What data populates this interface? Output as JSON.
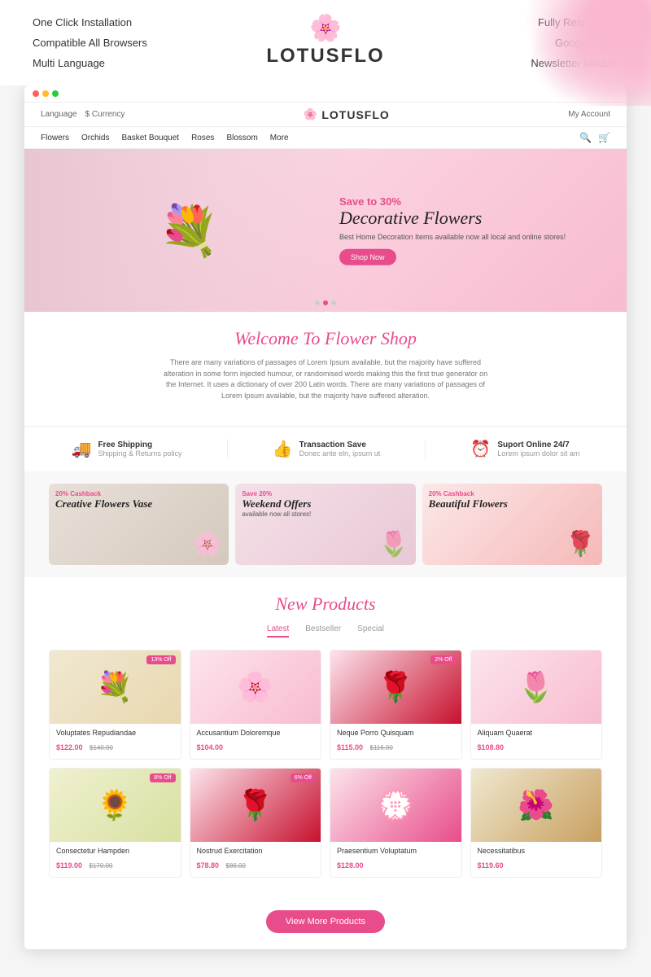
{
  "header": {
    "left_features": [
      "One Click Installation",
      "Compatible All Browsers",
      "Multi Language"
    ],
    "logo_text": "LOTUSFLO",
    "logo_icon": "🌸",
    "right_features": [
      "Fully Responsive",
      "Google Fonts",
      "Newsletter Module"
    ]
  },
  "shop": {
    "logo": "LOTUSFLO",
    "logo_icon": "🌸",
    "lang_label": "Language",
    "currency_label": "$ Currency",
    "account_label": "My Account",
    "nav_items": [
      "Flowers",
      "Orchids",
      "Basket Bouquet",
      "Roses",
      "Blossom",
      "More"
    ],
    "hero": {
      "save_text": "Save to 30%",
      "title": "Decorative Flowers",
      "desc": "Best Home Decoration Items available now\nall local and online stores!",
      "btn_label": "Shop Now"
    },
    "welcome": {
      "title": "Welcome To Flower Shop",
      "text": "There are many variations of passages of Lorem Ipsum available, but the majority have suffered alteration in some form injected humour, or randomised words making this the first true generator on the Internet. It uses a dictionary of over 200 Latin words. There are many variations of passages of Lorem Ipsum available, but the majority have suffered alteration."
    },
    "features": [
      {
        "icon": "🚚",
        "title": "Free Shipping",
        "sub": "Shipping & Returns policy"
      },
      {
        "icon": "👍",
        "title": "Transaction Save",
        "sub": "Donec ante eln, ipsum ut"
      },
      {
        "icon": "⏰",
        "title": "Suport Online 24/7",
        "sub": "Lorem ipsum dolor sit am"
      }
    ],
    "promos": [
      {
        "badge": "20% Cashback",
        "title": "Creative Flowers Vase",
        "sub": ""
      },
      {
        "badge": "Save 20%",
        "title": "Weekend Offers",
        "sub": "available now all stores!"
      },
      {
        "badge": "20% Cashback",
        "title": "Beautiful Flowers",
        "sub": ""
      }
    ],
    "new_products": {
      "section_title": "New Products",
      "tabs": [
        "Latest",
        "Bestseller",
        "Special"
      ],
      "active_tab": 0,
      "products": [
        {
          "name": "Voluptates Repudiandae",
          "price": "$122.00",
          "old_price": "$140.00",
          "discount": "13% Off",
          "img_class": "product-img-1"
        },
        {
          "name": "Accusantium Doloremque",
          "price": "$104.00",
          "old_price": "",
          "discount": "",
          "img_class": "product-img-2"
        },
        {
          "name": "Neque Porro Quisquam",
          "price": "$115.00",
          "old_price": "$116.00",
          "discount": "2% Off",
          "img_class": "product-img-3"
        },
        {
          "name": "Aliquam Quaerat",
          "price": "$108.80",
          "old_price": "",
          "discount": "",
          "img_class": "product-img-4"
        },
        {
          "name": "Consectetur Hampden",
          "price": "$119.00",
          "old_price": "$170.00",
          "discount": "8% Off",
          "img_class": "product-img-5"
        },
        {
          "name": "Nostrud Exercitation",
          "price": "$78.80",
          "old_price": "$86.00",
          "discount": "6% Off",
          "img_class": "product-img-6"
        },
        {
          "name": "Praesentium Voluptatum",
          "price": "$128.00",
          "old_price": "",
          "discount": "",
          "img_class": "product-img-7"
        },
        {
          "name": "Necessitatibus",
          "price": "$119.60",
          "old_price": "",
          "discount": "",
          "img_class": "product-img-8"
        }
      ],
      "view_more_btn": "View More Products"
    }
  }
}
